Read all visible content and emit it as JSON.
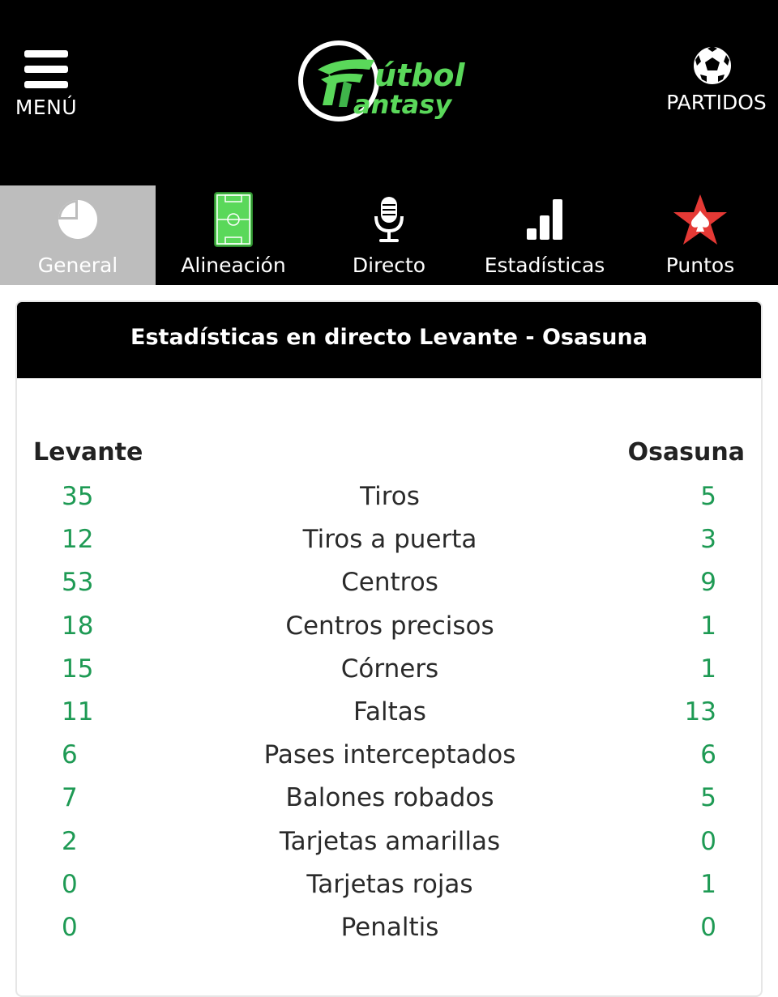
{
  "header": {
    "menu_label": "MENÚ",
    "logo_text_top": "útbol",
    "logo_text_bottom": "antasy",
    "matches_label": "PARTIDOS"
  },
  "tabs": [
    {
      "label": "General",
      "icon": "pie-chart-icon",
      "active": true
    },
    {
      "label": "Alineación",
      "icon": "football-pitch-icon",
      "active": false
    },
    {
      "label": "Directo",
      "icon": "microphone-icon",
      "active": false
    },
    {
      "label": "Estadísticas",
      "icon": "bar-chart-icon",
      "active": false
    },
    {
      "label": "Puntos",
      "icon": "star-icon",
      "active": false
    }
  ],
  "stats": {
    "title": "Estadísticas en directo Levante - Osasuna",
    "home_team": "Levante",
    "away_team": "Osasuna",
    "rows": [
      {
        "home": "35",
        "name": "Tiros",
        "away": "5"
      },
      {
        "home": "12",
        "name": "Tiros a puerta",
        "away": "3"
      },
      {
        "home": "53",
        "name": "Centros",
        "away": "9"
      },
      {
        "home": "18",
        "name": "Centros precisos",
        "away": "1"
      },
      {
        "home": "15",
        "name": "Córners",
        "away": "1"
      },
      {
        "home": "11",
        "name": "Faltas",
        "away": "13"
      },
      {
        "home": "6",
        "name": "Pases interceptados",
        "away": "6"
      },
      {
        "home": "7",
        "name": "Balones robados",
        "away": "5"
      },
      {
        "home": "2",
        "name": "Tarjetas amarillas",
        "away": "0"
      },
      {
        "home": "0",
        "name": "Tarjetas rojas",
        "away": "1"
      },
      {
        "home": "0",
        "name": "Penaltis",
        "away": "0"
      }
    ]
  },
  "colors": {
    "accent_green": "#1e9a54",
    "logo_green": "#5ad85a",
    "active_tab": "#bdbdbd",
    "star_red": "#e53935"
  }
}
